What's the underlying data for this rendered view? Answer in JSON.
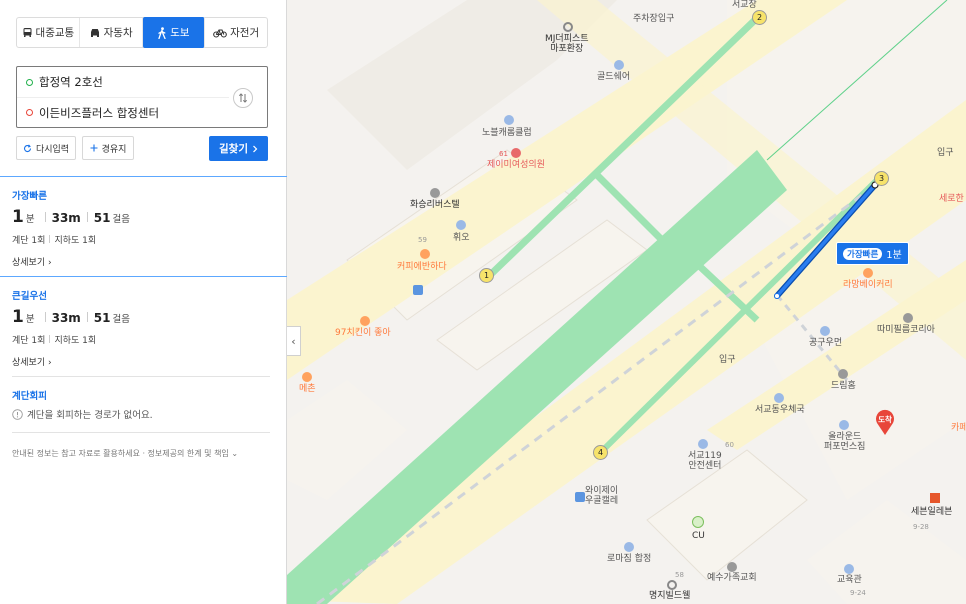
{
  "modes": {
    "transit": "대중교통",
    "car": "자동차",
    "walk": "도보",
    "bike": "자전거"
  },
  "route_input": {
    "start": "합정역 2호선",
    "end": "이든비즈플러스 합정센터"
  },
  "buttons": {
    "reset": "다시입력",
    "waypoint": "경유지",
    "find": "길찾기"
  },
  "routes": [
    {
      "label": "가장빠른",
      "minutes": "1",
      "min_unit": "분",
      "meters": "33m",
      "steps": "51",
      "steps_unit": "걸음",
      "stairs": "계단 1회",
      "underpass": "지하도 1회",
      "detail": "상세보기"
    },
    {
      "label": "큰길우선",
      "minutes": "1",
      "min_unit": "분",
      "meters": "33m",
      "steps": "51",
      "steps_unit": "걸음",
      "stairs": "계단 1회",
      "underpass": "지하도 1회",
      "detail": "상세보기"
    }
  ],
  "avoid": {
    "label": "계단회피",
    "message": "계단을 회피하는 경로가 없어요."
  },
  "notice": "안내된 정보는 참고 자료로 활용하세요 · 정보제공의 한계 및 책임",
  "map": {
    "route_tag_label": "가장빠른",
    "route_tag_time": "1분",
    "exits": [
      "1",
      "2",
      "3",
      "4"
    ],
    "pois": {
      "mj": "MJ더피스트\n마포환장",
      "parking": "주차장입구",
      "seogyojang": "서교장",
      "goldshare": "골드쉐어",
      "nobel": "노블캐롬클럽",
      "jeimi": "제이미여성의원",
      "jeimi_num": "61",
      "hwaseung": "화승리버스텔",
      "hwio": "휘오",
      "coffee_num": "59",
      "coffee": "커피에반하다",
      "chicken": "97치킨이 좋아",
      "mechon": "메촌",
      "iphap1": "입구",
      "seohyeon": "세로한",
      "lavibe": "라망베이커리",
      "tamtam": "따미필름코리아",
      "gonggu": "공구우먼",
      "dream": "드림홈",
      "post": "서교동우체국",
      "olive": "올라운드\n퍼포먼스짐",
      "arrive": "도착",
      "entrance": "입구",
      "fire": "서교119\n안전센터",
      "fire_num": "60",
      "waijei": "와이제이\n우골캘레",
      "cu": "CU",
      "seven": "세븐일레븐",
      "seven_num": "9-28",
      "romajip": "로마짐 합정",
      "yesu": "예수가족교회",
      "yesu_num": "58",
      "myeongji": "명지빌드웰",
      "church": "교육관",
      "church_num": "9-24",
      "kafe": "카페"
    }
  }
}
